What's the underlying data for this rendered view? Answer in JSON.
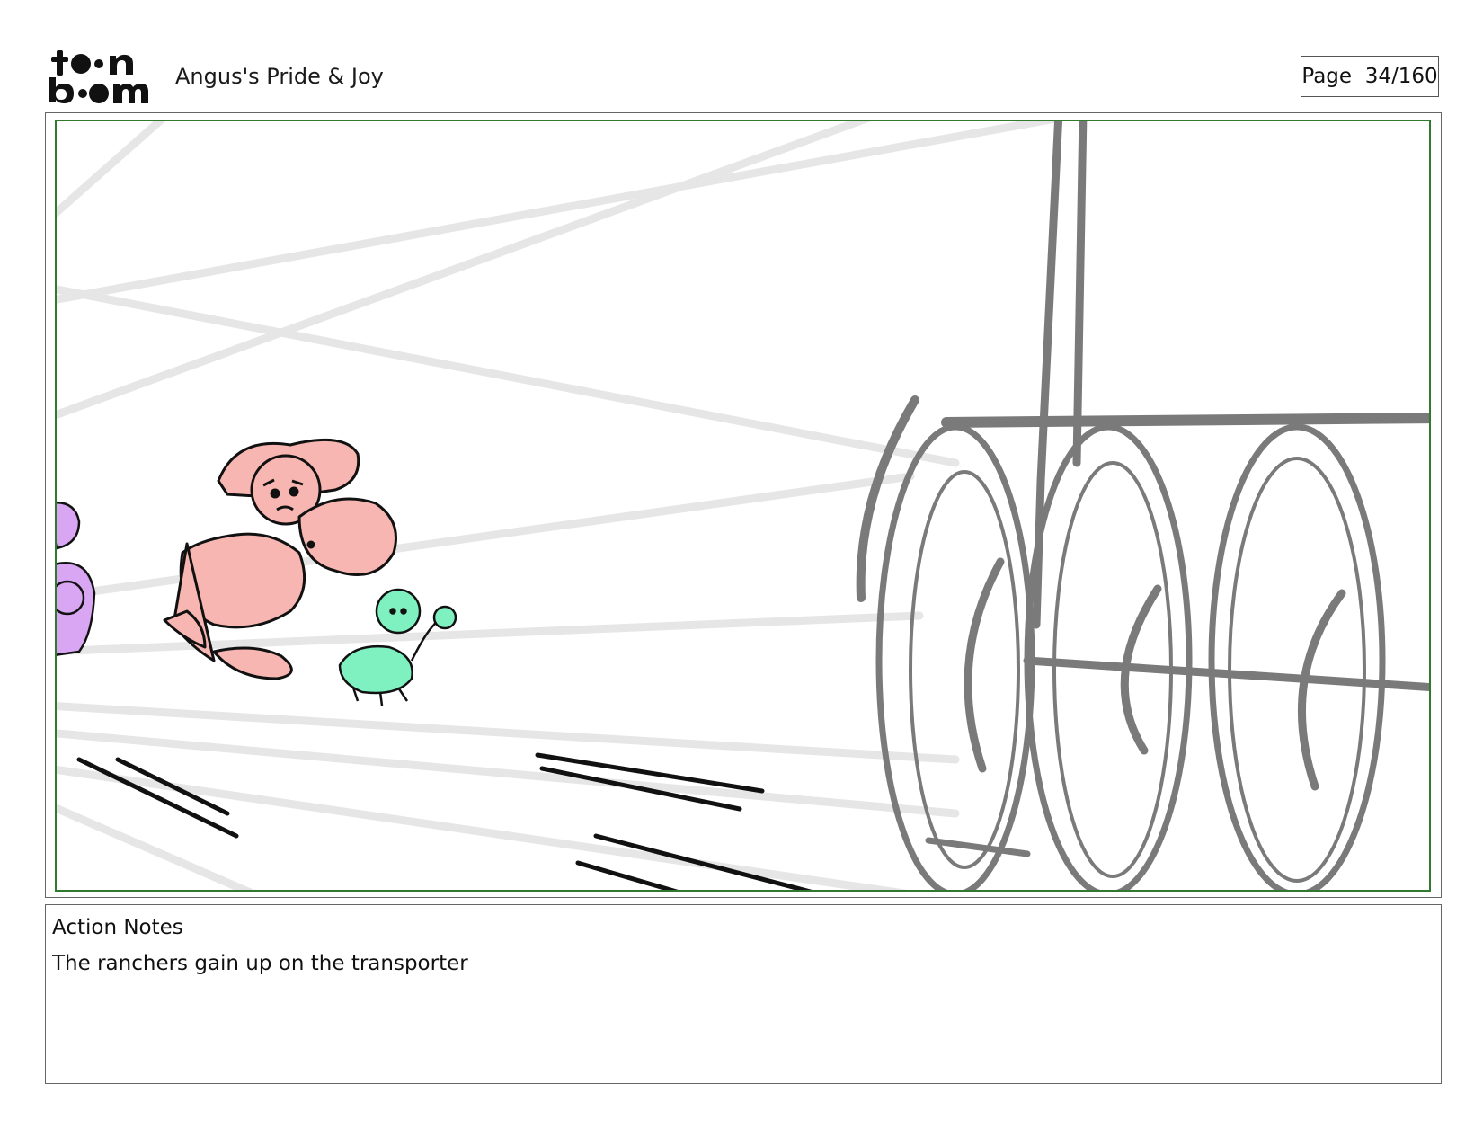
{
  "header": {
    "logo": {
      "text": "toon boom",
      "icon": "toon-boom-logo"
    },
    "project_title": "Angus's Pride & Joy",
    "page_label": "Page",
    "page_number": "34/160"
  },
  "panel": {
    "frame_color": "#2f7a2f",
    "sketch_colors": {
      "perspective_lines": "#e6e6e6",
      "vehicle": "#7a7a7a",
      "pink_rider": "#f7b6b1",
      "green_rider": "#7ff0c0",
      "purple_rider": "#d8a6f2",
      "ink": "#111111"
    }
  },
  "notes": {
    "heading": "Action Notes",
    "text": "The ranchers gain up on the transporter"
  }
}
